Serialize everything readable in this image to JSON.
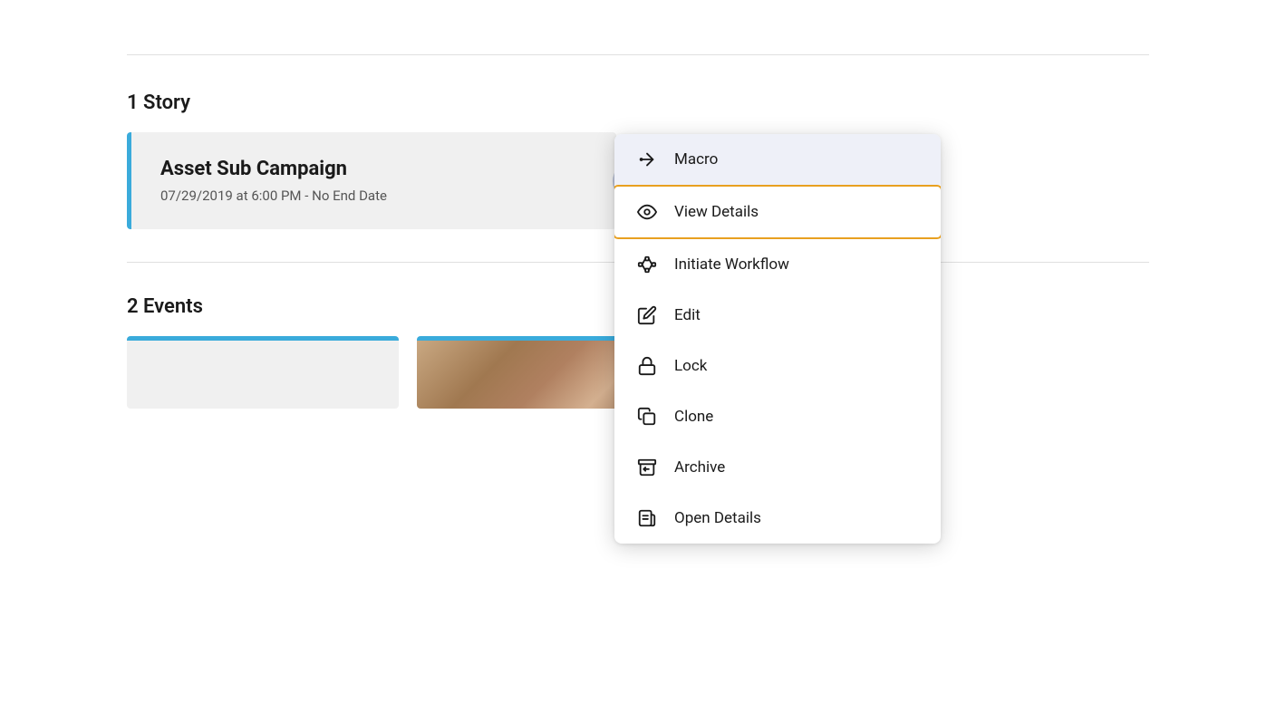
{
  "page": {
    "top_divider": true
  },
  "section1": {
    "label": "1 Story"
  },
  "story_card": {
    "title": "Asset Sub Campaign",
    "subtitle": "07/29/2019 at 6:00 PM - No End Date",
    "more_button_label": "···"
  },
  "section2": {
    "label": "2 Events"
  },
  "context_menu": {
    "items": [
      {
        "id": "macro",
        "label": "Macro",
        "icon": "macro-icon",
        "highlighted": true,
        "view_details": false
      },
      {
        "id": "view-details",
        "label": "View Details",
        "icon": "eye-icon",
        "highlighted": false,
        "view_details": true
      },
      {
        "id": "initiate-workflow",
        "label": "Initiate Workflow",
        "icon": "workflow-icon",
        "highlighted": false,
        "view_details": false
      },
      {
        "id": "edit",
        "label": "Edit",
        "icon": "edit-icon",
        "highlighted": false,
        "view_details": false
      },
      {
        "id": "lock",
        "label": "Lock",
        "icon": "lock-icon",
        "highlighted": false,
        "view_details": false
      },
      {
        "id": "clone",
        "label": "Clone",
        "icon": "clone-icon",
        "highlighted": false,
        "view_details": false
      },
      {
        "id": "archive",
        "label": "Archive",
        "icon": "archive-icon",
        "highlighted": false,
        "view_details": false
      },
      {
        "id": "open-details",
        "label": "Open Details",
        "icon": "open-details-icon",
        "highlighted": false,
        "view_details": false
      }
    ]
  }
}
